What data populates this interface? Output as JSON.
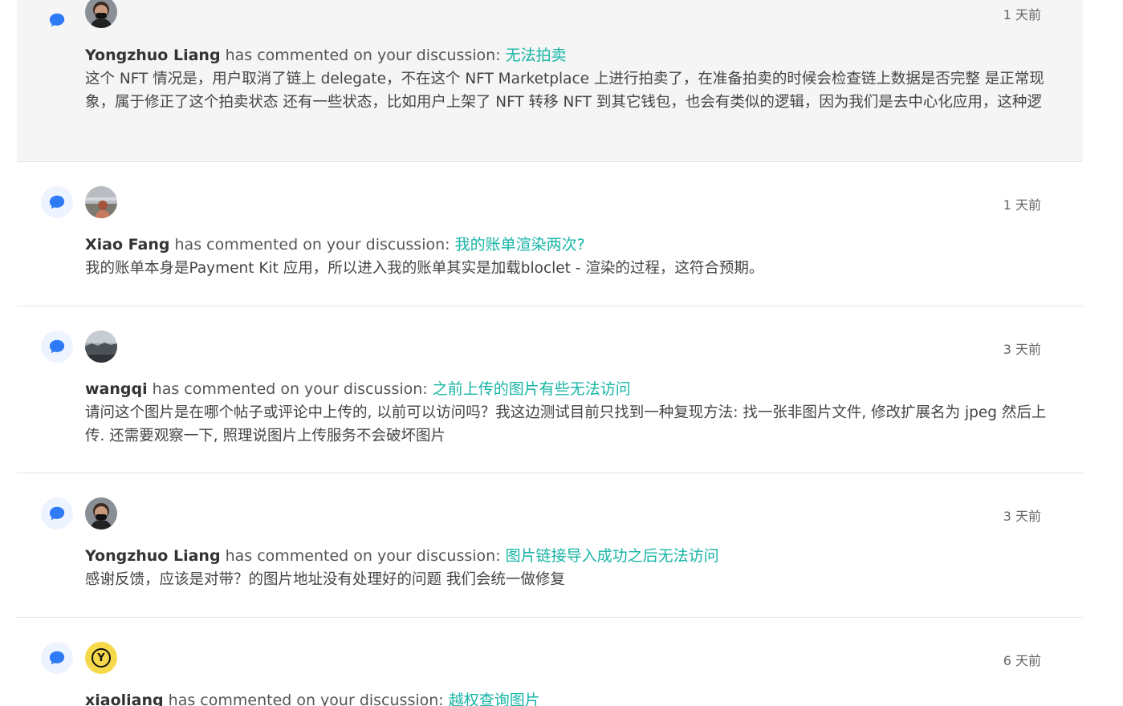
{
  "action_text": "has commented on your discussion:",
  "colors": {
    "link": "#16b5a5",
    "icon_blue": "#2f7bf5",
    "highlight_bg": "#f5f5f5"
  },
  "notifications": [
    {
      "author": "Yongzhuo Liang",
      "discussion_title": "无法拍卖",
      "time": "1 天前",
      "body": "这个 NFT 情况是，用户取消了链上 delegate，不在这个 NFT Marketplace 上进行拍卖了，在准备拍卖的时候会检查链上数据是否完整 是正常现象，属于修正了这个拍卖状态 还有一些状态，比如用户上架了 NFT 转移 NFT 到其它钱包，也会有类似的逻辑，因为我们是去中心化应用，这种逻",
      "icon": "comment-bubble-icon",
      "avatar": "photo"
    },
    {
      "author": "Xiao Fang",
      "discussion_title": "我的账单渲染两次?",
      "time": "1 天前",
      "body": "我的账单本身是Payment Kit 应用，所以进入我的账单其实是加载bloclet - 渲染的过程，这符合预期。",
      "icon": "comment-bubble-icon",
      "avatar": "photo"
    },
    {
      "author": "wangqi",
      "discussion_title": "之前上传的图片有些无法访问",
      "time": "3 天前",
      "body": "请问这个图片是在哪个帖子或评论中上传的, 以前可以访问吗？我这边测试目前只找到一种复现方法: 找一张非图片文件, 修改扩展名为 jpeg 然后上传. 还需要观察一下, 照理说图片上传服务不会破坏图片",
      "icon": "comment-bubble-icon",
      "avatar": "photo"
    },
    {
      "author": "Yongzhuo Liang",
      "discussion_title": "图片链接导入成功之后无法访问",
      "time": "3 天前",
      "body": "感谢反馈，应该是对带？的图片地址没有处理好的问题 我们会统一做修复",
      "icon": "comment-bubble-icon",
      "avatar": "photo"
    },
    {
      "author": "xiaoliang",
      "discussion_title": "越权查询图片",
      "time": "6 天前",
      "body": "",
      "icon": "comment-bubble-icon",
      "avatar": "Y"
    }
  ]
}
